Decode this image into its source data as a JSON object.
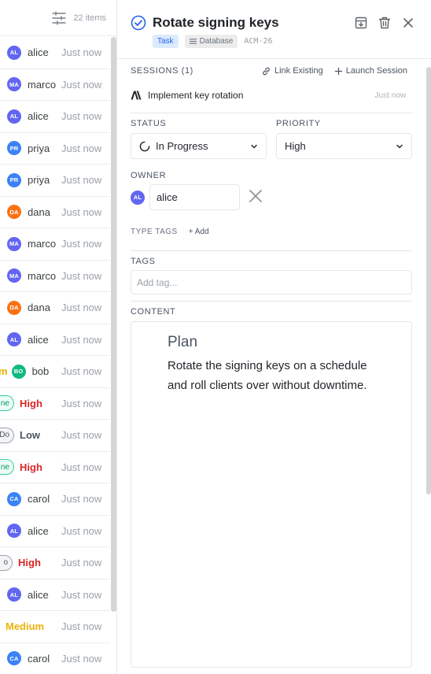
{
  "list": {
    "count_label": "22 items",
    "rows": [
      {
        "kind": "user",
        "initials": "AL",
        "name": "alice",
        "color": "#6366f1",
        "time": "Just now"
      },
      {
        "kind": "user",
        "initials": "MA",
        "name": "marco",
        "color": "#6366f1",
        "time": "Just now"
      },
      {
        "kind": "user",
        "initials": "AL",
        "name": "alice",
        "color": "#6366f1",
        "time": "Just now"
      },
      {
        "kind": "user",
        "initials": "PR",
        "name": "priya",
        "color": "#3b82f6",
        "time": "Just now"
      },
      {
        "kind": "user",
        "initials": "PR",
        "name": "priya",
        "color": "#3b82f6",
        "time": "Just now"
      },
      {
        "kind": "user",
        "initials": "DA",
        "name": "dana",
        "color": "#f97316",
        "time": "Just now"
      },
      {
        "kind": "user",
        "initials": "MA",
        "name": "marco",
        "color": "#6366f1",
        "time": "Just now"
      },
      {
        "kind": "user",
        "initials": "MA",
        "name": "marco",
        "color": "#6366f1",
        "time": "Just now"
      },
      {
        "kind": "user",
        "initials": "DA",
        "name": "dana",
        "color": "#f97316",
        "time": "Just now"
      },
      {
        "kind": "user",
        "initials": "AL",
        "name": "alice",
        "color": "#6366f1",
        "time": "Just now"
      },
      {
        "kind": "user",
        "initials": "BO",
        "name": "bob",
        "color": "#10b981",
        "time": "Just now",
        "prefix": "m"
      },
      {
        "kind": "priority",
        "chip": "ne",
        "chip_style": "green",
        "priority": "High",
        "time": "Just now"
      },
      {
        "kind": "priority",
        "chip": "Do",
        "chip_style": "gray",
        "priority": "Low",
        "time": "Just now"
      },
      {
        "kind": "priority",
        "chip": "ne",
        "chip_style": "green",
        "priority": "High",
        "time": "Just now"
      },
      {
        "kind": "user",
        "initials": "CA",
        "name": "carol",
        "color": "#3b82f6",
        "time": "Just now"
      },
      {
        "kind": "user",
        "initials": "AL",
        "name": "alice",
        "color": "#6366f1",
        "time": "Just now"
      },
      {
        "kind": "priority",
        "chip": "o",
        "chip_style": "gray",
        "priority": "High",
        "time": "Just now"
      },
      {
        "kind": "user",
        "initials": "AL",
        "name": "alice",
        "color": "#6366f1",
        "time": "Just now"
      },
      {
        "kind": "priority",
        "chip": "",
        "chip_style": "none",
        "priority": "Medium",
        "time": "Just now"
      },
      {
        "kind": "user",
        "initials": "CA",
        "name": "carol",
        "color": "#3b82f6",
        "time": "Just now"
      }
    ]
  },
  "detail": {
    "title": "Rotate signing keys",
    "type_badge": "Task",
    "db_badge": "Database",
    "identifier": "ACM-26",
    "sessions": {
      "label": "SESSIONS (1)",
      "link_existing": "Link Existing",
      "launch_session": "Launch Session",
      "items": [
        {
          "name": "Implement key rotation",
          "time": "Just now"
        }
      ]
    },
    "status": {
      "label": "STATUS",
      "value": "In Progress"
    },
    "priority": {
      "label": "PRIORITY",
      "value": "High"
    },
    "owner": {
      "label": "OWNER",
      "initials": "AL",
      "value": "alice"
    },
    "type_tags": {
      "label": "TYPE TAGS",
      "add": "+ Add"
    },
    "tags": {
      "label": "TAGS",
      "placeholder": "Add tag..."
    },
    "content": {
      "label": "CONTENT",
      "heading": "Plan",
      "paragraph": "Rotate the signing keys on a schedule and roll clients over without downtime."
    }
  },
  "colors": {
    "accent": "#2563eb",
    "priority_high": "#dc2626",
    "priority_low": "#4b5563",
    "priority_medium": "#eab308"
  }
}
